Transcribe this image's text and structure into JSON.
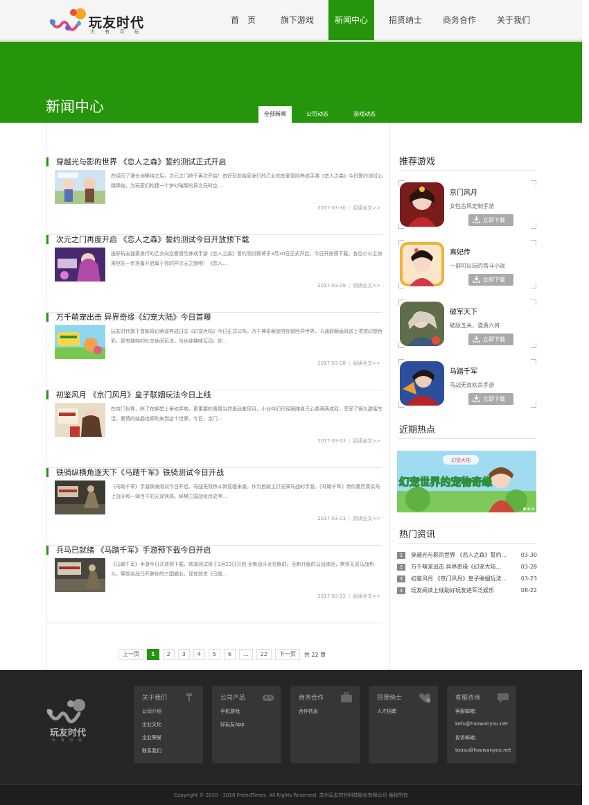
{
  "brand": {
    "name": "玩友时代",
    "sub": "大 有 可 玩"
  },
  "nav": [
    {
      "label": "首　页"
    },
    {
      "label": "旗下游戏"
    },
    {
      "label": "新闻中心"
    },
    {
      "label": "招贤纳士"
    },
    {
      "label": "商务合作"
    },
    {
      "label": "关于我们"
    }
  ],
  "banner": {
    "title": "新闻中心"
  },
  "subtabs": [
    {
      "label": "全部新闻"
    },
    {
      "label": "公司动态"
    },
    {
      "label": "游戏动态"
    }
  ],
  "articles": [
    {
      "title": "穿越光与影的世界 《恋人之森》誓约测试正式开启",
      "summary": "在经历了漫长地等待之后，次元之门终于再次开启！由好玩友独家发行的乙女向恋爱冒险养成手游《恋人之森》今日誓约测试心跳降临，为玩家们构建一个梦幻璀璨的异次元时空...",
      "date": "2017-03-30",
      "more": "阅读全文>>"
    },
    {
      "title": "次元之门再度开启 《恋人之森》誓约测试今日开放预下载",
      "summary": "由好玩友独家发行的乙女向恋爱冒险养成手游《恋人之森》誓约测试即将于3月30日正式开启，今日开放预下载，各位小公主快来抢先一步准备开启属于你的异次元之旅吧！《恋人...",
      "date": "2017-03-29",
      "more": "阅读全文>>"
    },
    {
      "title": "万千萌宠出击 异界奇缘《幻宠大陆》今日首曝",
      "summary": "玩友时代旗下首款奇幻萌宠养成日志《幻宠大陆》今日正式公布。万千神奇萌宠陪你冒险异世界，卡通软萌画风送上浓浓幻想色彩，更有独特的社交休闲玩法，与伙伴趣味互动，你...",
      "date": "2017-03-28",
      "more": "阅读全文>>"
    },
    {
      "title": "初鉴风月 《京门风月》皇子联姻玩法今日上线",
      "summary": "在京门世界，除了在朝堂上争权弄势，更重要的事情当然是品鉴风月，小伙伴们已经跟随自己心意两两成双，享受了很久甜蜜生活，爱情的结晶也顺利来到这个世界。今日，京门...",
      "date": "2017-03-23",
      "more": "阅读全文>>"
    },
    {
      "title": "铁骑纵横角逐天下《马踏千军》铁骑测试今日开战",
      "summary": "《马踏千军》手游铁骑测试今日开启，马战无双热斗新征程来袭。作为首款主打无双马战的手游，《马踏千军》带你重历真实马上战斗和一骑当千的无双快感。纵横三国战役历史序...",
      "date": "2017-03-23",
      "more": "阅读全文>>"
    },
    {
      "title": "兵马已就绪 《马踏千军》手游预下载今日开启",
      "summary": "《马踏千军》手游今日开放预下载，铁骑测试将于3月23日开启,全新战斗近在眼前。全新升级的马战体验，爽快无双马战热斗，等奴名战马开辟你的三国霸业。现在前去《马踏...",
      "date": "2017-03-22",
      "more": "阅读全文>>"
    }
  ],
  "pager": {
    "prev": "上一页",
    "pages": [
      "1",
      "2",
      "3",
      "4",
      "5",
      "6",
      "...",
      "22"
    ],
    "next": "下一页",
    "total": "共 22 页"
  },
  "sidebar": {
    "rec_title": "推荐游戏",
    "games": [
      {
        "name": "京门风月",
        "desc": "女性古风定制手游",
        "btn": "立即下载"
      },
      {
        "name": "熹妃传",
        "desc": "一部可以玩的宫斗小说",
        "btn": "立即下载"
      },
      {
        "name": "破军天下",
        "desc": "破敌五关，骁勇六将",
        "btn": "立即下载"
      },
      {
        "name": "马踏千军",
        "desc": "马战无双欢杀手游",
        "btn": "立即下载"
      }
    ],
    "hot_title": "近期热点",
    "hot_banner": {
      "title": "幻宠世界的宠物奇缘",
      "tag": "幻宠大陆"
    },
    "news_title": "热门资讯",
    "news": [
      {
        "num": "1",
        "title": "穿越光与影的世界 《恋人之森》誓约...",
        "date": "03-30"
      },
      {
        "num": "2",
        "title": "万千萌宠出击 异界奇缘《幻宠大陆...",
        "date": "03-28"
      },
      {
        "num": "3",
        "title": "初鉴风月 《京门风月》皇子联姻玩法...",
        "date": "03-23"
      },
      {
        "num": "4",
        "title": "玩友阅读上线助好玩友进军泛娱乐",
        "date": "08-22"
      }
    ]
  },
  "footer": {
    "brand": "玩友时代",
    "brand_sub": "大 有 可 玩",
    "cols": [
      {
        "title": "关于我们",
        "icon": "hammer-icon",
        "items": [
          "公司介绍",
          "企业文化",
          "企业荣誉",
          "联系我们"
        ]
      },
      {
        "title": "公司产品",
        "icon": "gamepad-icon",
        "items": [
          "手机游戏",
          "好玩友App"
        ]
      },
      {
        "title": "商务合作",
        "icon": "briefcase-icon",
        "items": [
          "合作信息"
        ]
      },
      {
        "title": "招贤纳士",
        "icon": "heart-add-icon",
        "items": [
          "人才招聘"
        ]
      },
      {
        "title": "客服咨询",
        "icon": "chat-icon",
        "items": [
          "客服邮箱：",
          "kefu@haowanyou.net",
          "投诉邮箱：",
          "tousu@haowanyou.net"
        ]
      }
    ],
    "copyright": "Copyright © 2010 - 2016 FriendTimes. All Rights Reserved. 苏州玩友时代科技股份有限公司 版权所有"
  },
  "colors": {
    "accent": "#25950b",
    "footer_bg": "#262626",
    "footer_box": "#363636"
  }
}
